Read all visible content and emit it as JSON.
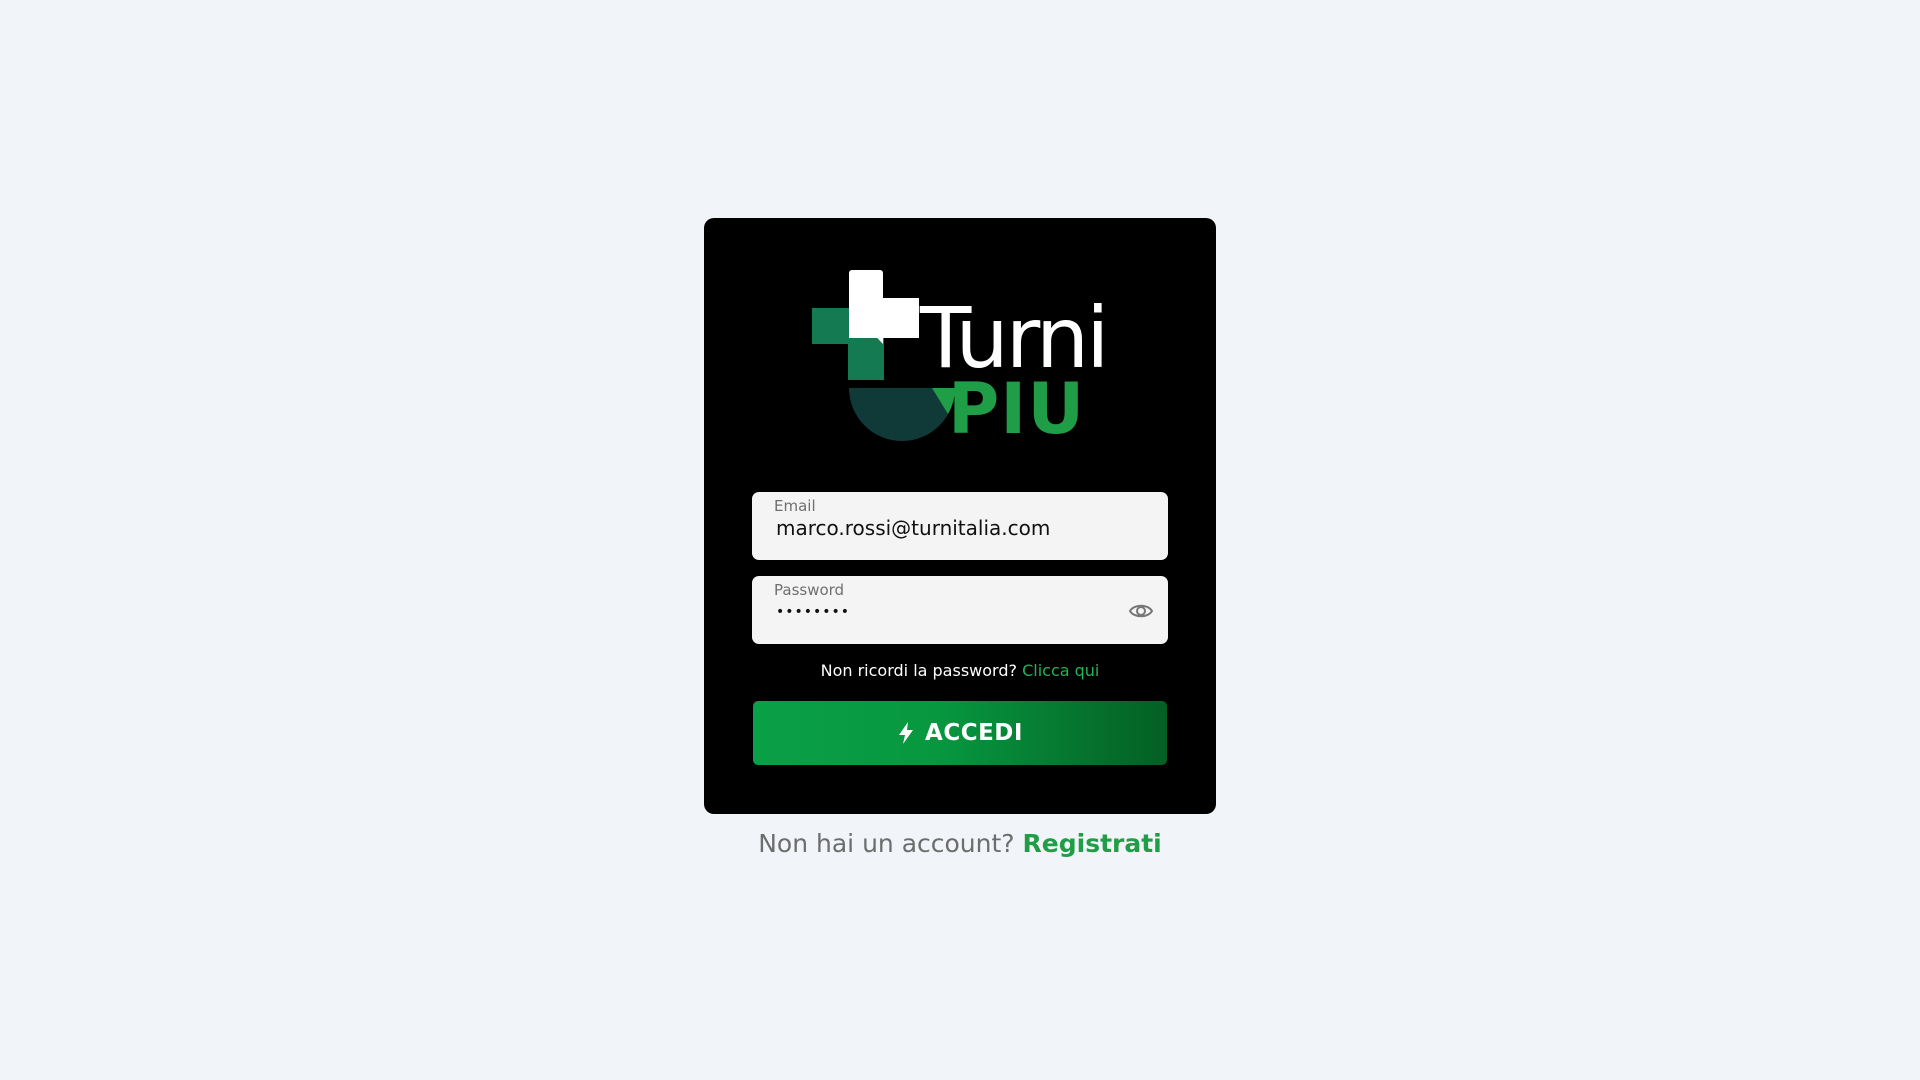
{
  "brand": {
    "name_line1": "Turni",
    "name_line2": "PIU",
    "colors": {
      "white": "#ffffff",
      "green": "#1f9e47",
      "dark_green": "#147a52",
      "teal_dark": "#0f3a38"
    },
    "icon": "medical-cross-logo-icon"
  },
  "form": {
    "email": {
      "label": "Email",
      "value": "marco.rossi@turnitalia.com"
    },
    "password": {
      "label": "Password",
      "value": "••••••••",
      "toggle_icon": "eye-icon"
    },
    "forgot": {
      "text": "Non ricordi la password?",
      "link": "Clicca qui"
    },
    "submit": {
      "label": "ACCEDI",
      "icon": "lightning-icon"
    }
  },
  "signup": {
    "text": "Non hai un account?",
    "link": "Registrati"
  },
  "colors": {
    "page_background": "#f1f4f8",
    "card_background": "#000000",
    "accent_link": "#22b452",
    "button_start": "#0aa047",
    "button_end": "#045f24"
  }
}
